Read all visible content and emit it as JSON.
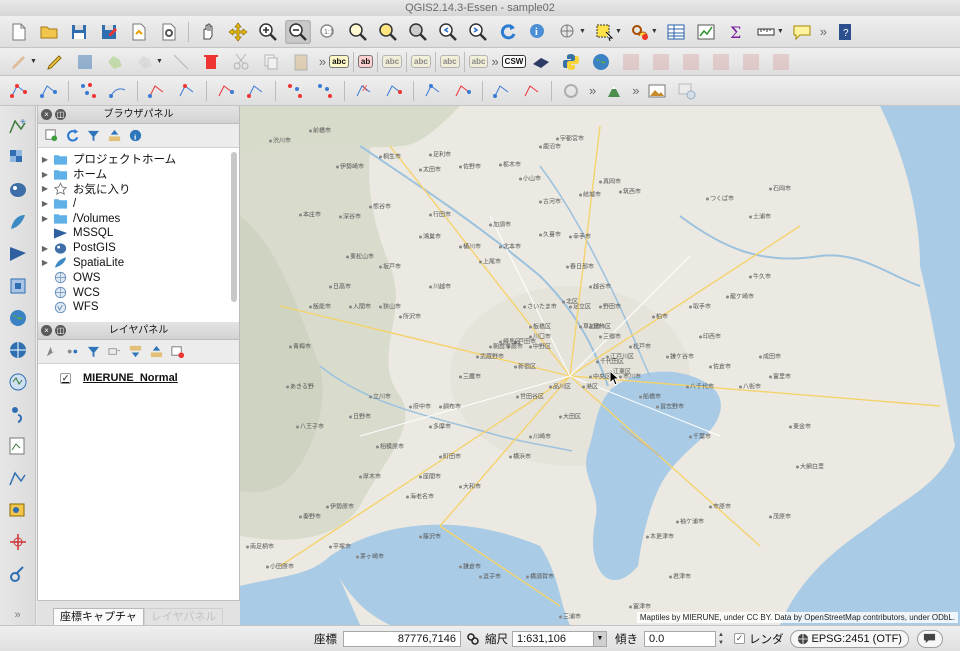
{
  "window": {
    "title": "QGIS2.14.3-Essen - sample02"
  },
  "toolbars": {
    "main_icons": [
      "new-project-icon",
      "open-project-icon",
      "save-project-icon",
      "save-as-icon",
      "new-print-composer-icon",
      "composer-manager-icon",
      "pan-icon",
      "pan-to-selection-icon",
      "zoom-in-icon",
      "zoom-out-icon",
      "zoom-full-icon",
      "zoom-to-selection-icon",
      "zoom-to-layer-icon",
      "zoom-native-icon",
      "zoom-last-icon",
      "zoom-next-icon",
      "refresh-icon",
      "identify-icon",
      "select-icon",
      "deselect-icon",
      "measure-icon",
      "attribute-table-icon",
      "field-calculator-icon",
      "statistics-icon",
      "sum-icon",
      "measure-line-icon",
      "annotation-icon",
      "help-icon"
    ],
    "edit_label_buttons": [
      "abc",
      "ab",
      "abc",
      "abc",
      "abc",
      "abc"
    ],
    "csw_label": "CSW"
  },
  "browser_panel": {
    "title": "ブラウザパネル",
    "items": [
      {
        "label": "プロジェクトホーム",
        "icon": "folder-icon",
        "expandable": true
      },
      {
        "label": "ホーム",
        "icon": "folder-icon",
        "expandable": true
      },
      {
        "label": "お気に入り",
        "icon": "star-icon",
        "expandable": true
      },
      {
        "label": "/",
        "icon": "folder-icon",
        "expandable": true
      },
      {
        "label": "/Volumes",
        "icon": "folder-icon",
        "expandable": true
      },
      {
        "label": "MSSQL",
        "icon": "mssql-icon",
        "expandable": false
      },
      {
        "label": "PostGIS",
        "icon": "postgis-icon",
        "expandable": true
      },
      {
        "label": "SpatiaLite",
        "icon": "spatialite-icon",
        "expandable": true
      },
      {
        "label": "OWS",
        "icon": "ows-icon",
        "expandable": false
      },
      {
        "label": "WCS",
        "icon": "wcs-icon",
        "expandable": false
      },
      {
        "label": "WFS",
        "icon": "wfs-icon",
        "expandable": false
      }
    ]
  },
  "layer_panel": {
    "title": "レイヤパネル",
    "layers": [
      {
        "name": "MIERUNE_Normal",
        "checked": true
      }
    ]
  },
  "bottom_tabs": [
    {
      "label": "座標キャプチャ",
      "active": true
    },
    {
      "label": "レイヤパネル",
      "active": false
    }
  ],
  "map": {
    "attribution": "Maptiles by MIERUNE, under CC BY. Data by OpenStreetMap contributors, under ODbL.",
    "places": [
      [
        "前橋市",
        80,
        24
      ],
      [
        "渋川市",
        40,
        34
      ],
      [
        "桐生市",
        150,
        50
      ],
      [
        "伊勢崎市",
        110,
        60
      ],
      [
        "太田市",
        190,
        63
      ],
      [
        "足利市",
        200,
        48
      ],
      [
        "宇都宮市",
        330,
        32
      ],
      [
        "鹿沼市",
        310,
        40
      ],
      [
        "栃木市",
        270,
        58
      ],
      [
        "佐野市",
        230,
        60
      ],
      [
        "小山市",
        290,
        72
      ],
      [
        "真岡市",
        370,
        75
      ],
      [
        "筑西市",
        390,
        85
      ],
      [
        "結城市",
        350,
        88
      ],
      [
        "古河市",
        310,
        95
      ],
      [
        "つくば市",
        480,
        92
      ],
      [
        "土浦市",
        520,
        110
      ],
      [
        "石岡市",
        540,
        82
      ],
      [
        "熊谷市",
        140,
        100
      ],
      [
        "行田市",
        200,
        108
      ],
      [
        "加須市",
        260,
        118
      ],
      [
        "久喜市",
        310,
        128
      ],
      [
        "幸手市",
        340,
        130
      ],
      [
        "深谷市",
        110,
        110
      ],
      [
        "本庄市",
        70,
        108
      ],
      [
        "鴻巣市",
        190,
        130
      ],
      [
        "東松山市",
        120,
        150
      ],
      [
        "坂戸市",
        150,
        160
      ],
      [
        "川越市",
        200,
        180
      ],
      [
        "上尾市",
        250,
        155
      ],
      [
        "桶川市",
        230,
        140
      ],
      [
        "北本市",
        270,
        140
      ],
      [
        "さいたま市",
        300,
        200
      ],
      [
        "春日部市",
        340,
        160
      ],
      [
        "越谷市",
        360,
        180
      ],
      [
        "野田市",
        370,
        200
      ],
      [
        "柏市",
        420,
        210
      ],
      [
        "取手市",
        460,
        200
      ],
      [
        "龍ケ崎市",
        500,
        190
      ],
      [
        "牛久市",
        520,
        170
      ],
      [
        "成田市",
        530,
        250
      ],
      [
        "佐倉市",
        480,
        260
      ],
      [
        "八街市",
        510,
        280
      ],
      [
        "富里市",
        540,
        270
      ],
      [
        "印西市",
        470,
        230
      ],
      [
        "鎌ケ谷市",
        440,
        250
      ],
      [
        "船橋市",
        410,
        290
      ],
      [
        "千葉市",
        460,
        330
      ],
      [
        "市原市",
        480,
        400
      ],
      [
        "木更津市",
        420,
        430
      ],
      [
        "袖ケ浦市",
        450,
        415
      ],
      [
        "君津市",
        440,
        470
      ],
      [
        "富津市",
        400,
        500
      ],
      [
        "茂原市",
        540,
        410
      ],
      [
        "東金市",
        560,
        320
      ],
      [
        "大網白里",
        570,
        360
      ],
      [
        "八千代市",
        460,
        280
      ],
      [
        "習志野市",
        430,
        300
      ],
      [
        "松戸市",
        400,
        240
      ],
      [
        "市川市",
        390,
        270
      ],
      [
        "三郷市",
        370,
        230
      ],
      [
        "草加市",
        350,
        220
      ],
      [
        "川口市",
        300,
        230
      ],
      [
        "戸田市",
        285,
        235
      ],
      [
        "蕨市",
        275,
        240
      ],
      [
        "朝霞市",
        260,
        240
      ],
      [
        "所沢市",
        170,
        210
      ],
      [
        "狭山市",
        150,
        200
      ],
      [
        "入間市",
        120,
        200
      ],
      [
        "飯能市",
        80,
        200
      ],
      [
        "日高市",
        100,
        180
      ],
      [
        "青梅市",
        60,
        240
      ],
      [
        "あきる野",
        60,
        280
      ],
      [
        "八王子市",
        70,
        320
      ],
      [
        "日野市",
        120,
        310
      ],
      [
        "立川市",
        140,
        290
      ],
      [
        "府中市",
        180,
        300
      ],
      [
        "調布市",
        210,
        300
      ],
      [
        "三鷹市",
        230,
        270
      ],
      [
        "武蔵野市",
        250,
        250
      ],
      [
        "新宿区",
        285,
        260
      ],
      [
        "練馬区",
        270,
        235
      ],
      [
        "板橋区",
        300,
        220
      ],
      [
        "北区",
        330,
        195
      ],
      [
        "足立区",
        340,
        200
      ],
      [
        "葛飾区",
        360,
        220
      ],
      [
        "江戸川区",
        380,
        250
      ],
      [
        "中野区",
        300,
        240
      ],
      [
        "世田谷区",
        290,
        290
      ],
      [
        "大田区",
        330,
        310
      ],
      [
        "品川区",
        320,
        280
      ],
      [
        "千代田区",
        370,
        255
      ],
      [
        "中央区",
        360,
        270
      ],
      [
        "江東区",
        380,
        265
      ],
      [
        "港区",
        350,
        280
      ],
      [
        "多摩市",
        200,
        320
      ],
      [
        "町田市",
        210,
        350
      ],
      [
        "相模原市",
        150,
        340
      ],
      [
        "大和市",
        230,
        380
      ],
      [
        "座間市",
        190,
        370
      ],
      [
        "海老名市",
        180,
        390
      ],
      [
        "厚木市",
        130,
        370
      ],
      [
        "伊勢原市",
        100,
        400
      ],
      [
        "秦野市",
        70,
        410
      ],
      [
        "平塚市",
        100,
        440
      ],
      [
        "茅ヶ崎市",
        130,
        450
      ],
      [
        "藤沢市",
        190,
        430
      ],
      [
        "鎌倉市",
        230,
        460
      ],
      [
        "逗子市",
        250,
        470
      ],
      [
        "横浜市",
        280,
        350
      ],
      [
        "川崎市",
        300,
        330
      ],
      [
        "横須賀市",
        300,
        470
      ],
      [
        "三浦市",
        330,
        510
      ],
      [
        "小田原市",
        40,
        460
      ],
      [
        "南足柄市",
        20,
        440
      ]
    ]
  },
  "status_bar": {
    "coord_label": "座標",
    "coord_value": "87776,7146",
    "scale_label": "縮尺",
    "scale_value": "1:631,106",
    "rotation_label": "傾き",
    "rotation_value": "0.0",
    "render_label": "レンダ",
    "render_checked": true,
    "crs_label": "EPSG:2451 (OTF)"
  }
}
